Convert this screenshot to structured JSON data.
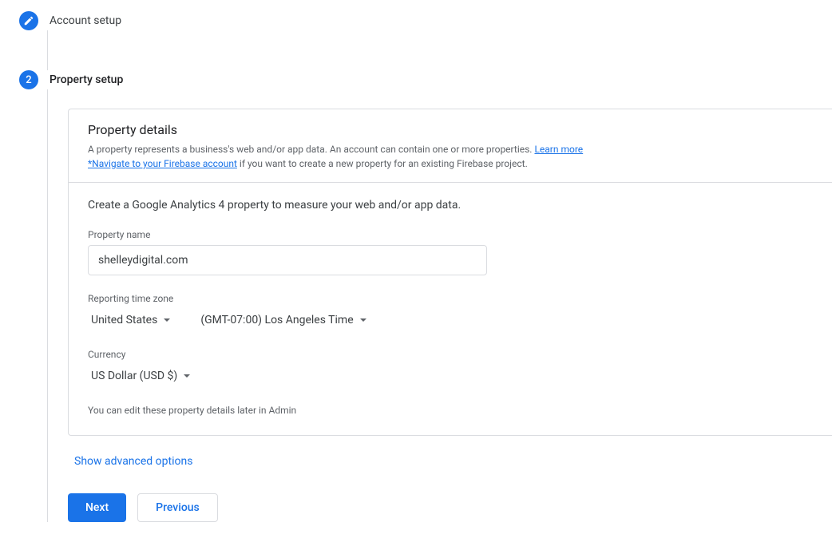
{
  "steps": {
    "account_setup": "Account setup",
    "property_setup_number": "2",
    "property_setup": "Property setup"
  },
  "card": {
    "title": "Property details",
    "desc_prefix": "A property represents a business's web and/or app data. An account can contain one or more properties. ",
    "learn_more": "Learn more",
    "firebase_link": "*Navigate to your Firebase account",
    "desc_suffix": " if you want to create a new property for an existing Firebase project.",
    "instruction": "Create a Google Analytics 4 property to measure your web and/or app data.",
    "property_name_label": "Property name",
    "property_name_value": "shelleydigital.com",
    "reporting_time_zone_label": "Reporting time zone",
    "country_value": "United States",
    "timezone_value": "(GMT-07:00) Los Angeles Time",
    "currency_label": "Currency",
    "currency_value": "US Dollar (USD $)",
    "note": "You can edit these property details later in Admin"
  },
  "advanced_options": "Show advanced options",
  "buttons": {
    "next": "Next",
    "previous": "Previous"
  }
}
